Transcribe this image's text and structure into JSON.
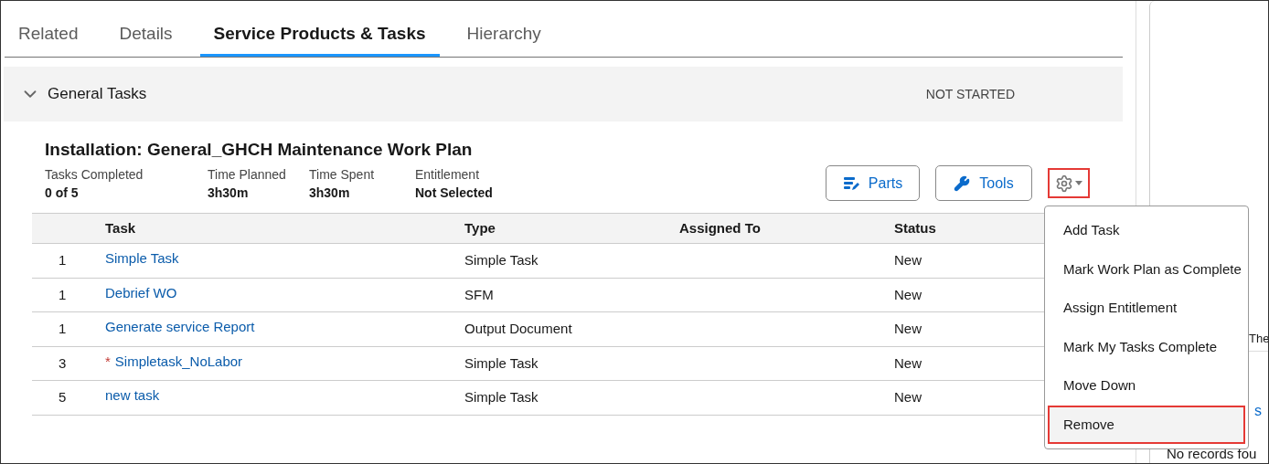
{
  "tabs": [
    {
      "label": "Related",
      "selected": false
    },
    {
      "label": "Details",
      "selected": false
    },
    {
      "label": "Service Products & Tasks",
      "selected": true
    },
    {
      "label": "Hierarchy",
      "selected": false
    }
  ],
  "section": {
    "title": "General Tasks",
    "expanded": true,
    "status": "NOT STARTED"
  },
  "work_plan": {
    "title": "Installation: General_GHCH Maintenance Work Plan",
    "stats": [
      {
        "label": "Tasks Completed",
        "value": "0 of 5"
      },
      {
        "label": "Time Planned",
        "value": "3h30m"
      },
      {
        "label": "Time Spent",
        "value": "3h30m"
      },
      {
        "label": "Entitlement",
        "value": "Not Selected"
      }
    ],
    "buttons": [
      {
        "label": "Parts",
        "kind": "parts"
      },
      {
        "label": "Tools",
        "kind": "tools"
      }
    ],
    "settings_button": {
      "highlighted": true
    }
  },
  "table": {
    "columns": [
      "Task",
      "Type",
      "Assigned To",
      "Status"
    ],
    "rows": [
      {
        "number": "1",
        "task": "Simple Task",
        "required": false,
        "type": "Simple Task",
        "status": "New"
      },
      {
        "number": "1",
        "task": "Debrief WO",
        "required": false,
        "type": "SFM",
        "status": "New"
      },
      {
        "number": "1",
        "task": "Generate service Report",
        "required": false,
        "type": "Output Document",
        "status": "New"
      },
      {
        "number": "3",
        "task": "Simpletask_NoLabor",
        "required": true,
        "required_mark": "*",
        "type": "Simple Task",
        "status": "New"
      },
      {
        "number": "5",
        "task": "new task",
        "required": false,
        "type": "Simple Task",
        "status": "New"
      }
    ]
  },
  "menu": [
    {
      "label": "Add Task",
      "selected": false,
      "highlighted": false
    },
    {
      "label": "Mark Work Plan as Complete",
      "selected": false,
      "highlighted": false
    },
    {
      "label": "Assign Entitlement",
      "selected": false,
      "highlighted": false
    },
    {
      "label": "Mark My Tasks Complete",
      "selected": false,
      "highlighted": false
    },
    {
      "label": "Move Down",
      "selected": false,
      "highlighted": false
    },
    {
      "label": "Remove",
      "selected": true,
      "highlighted": true
    }
  ],
  "side_panel": {
    "text": "The",
    "link": "s",
    "empty_text": "No records fou"
  }
}
